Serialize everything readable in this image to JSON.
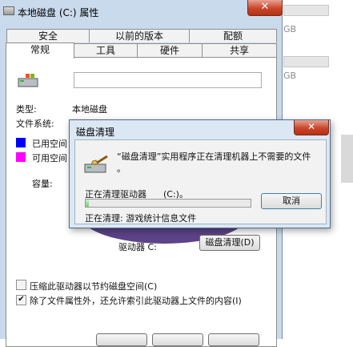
{
  "window": {
    "title": "本地磁盘 (C:) 属性",
    "close_label": "✕"
  },
  "background": {
    "gb_label_1": "GB",
    "gb_label_2": "GB"
  },
  "tabs_row1": [
    "安全",
    "以前的版本",
    "配额"
  ],
  "tabs_row2": [
    "常规",
    "工具",
    "硬件",
    "共享"
  ],
  "general": {
    "type_label": "类型:",
    "type_value": "本地磁盘",
    "fs_label": "文件系统:",
    "used_label": "已用空间",
    "free_label": "可用空间",
    "capacity_label": "容量:",
    "drive_label": "驱动器 C:",
    "cleanup_button": "磁盘清理(D)",
    "compress_label": "压缩此驱动器以节约磁盘空间(C)",
    "index_label": "除了文件属性外，还允许索引此驱动器上文件的内容(I)",
    "compress_checked": false,
    "index_checked": true
  },
  "colors": {
    "used": "#0000ff",
    "free": "#ff00ff",
    "accent": "#c9daec"
  },
  "cleanup_dialog": {
    "title": "磁盘清理",
    "close_label": "✕",
    "message_line1": "“磁盘清理”实用程序正在清理机器上不需要的文件",
    "message_line2": "。",
    "status_label": "正在清理驱动器",
    "status_drive": "(C:)。",
    "cancel_button": "取消",
    "current_item": "正在清理:  游戏统计信息文件",
    "progress": 0.02
  }
}
